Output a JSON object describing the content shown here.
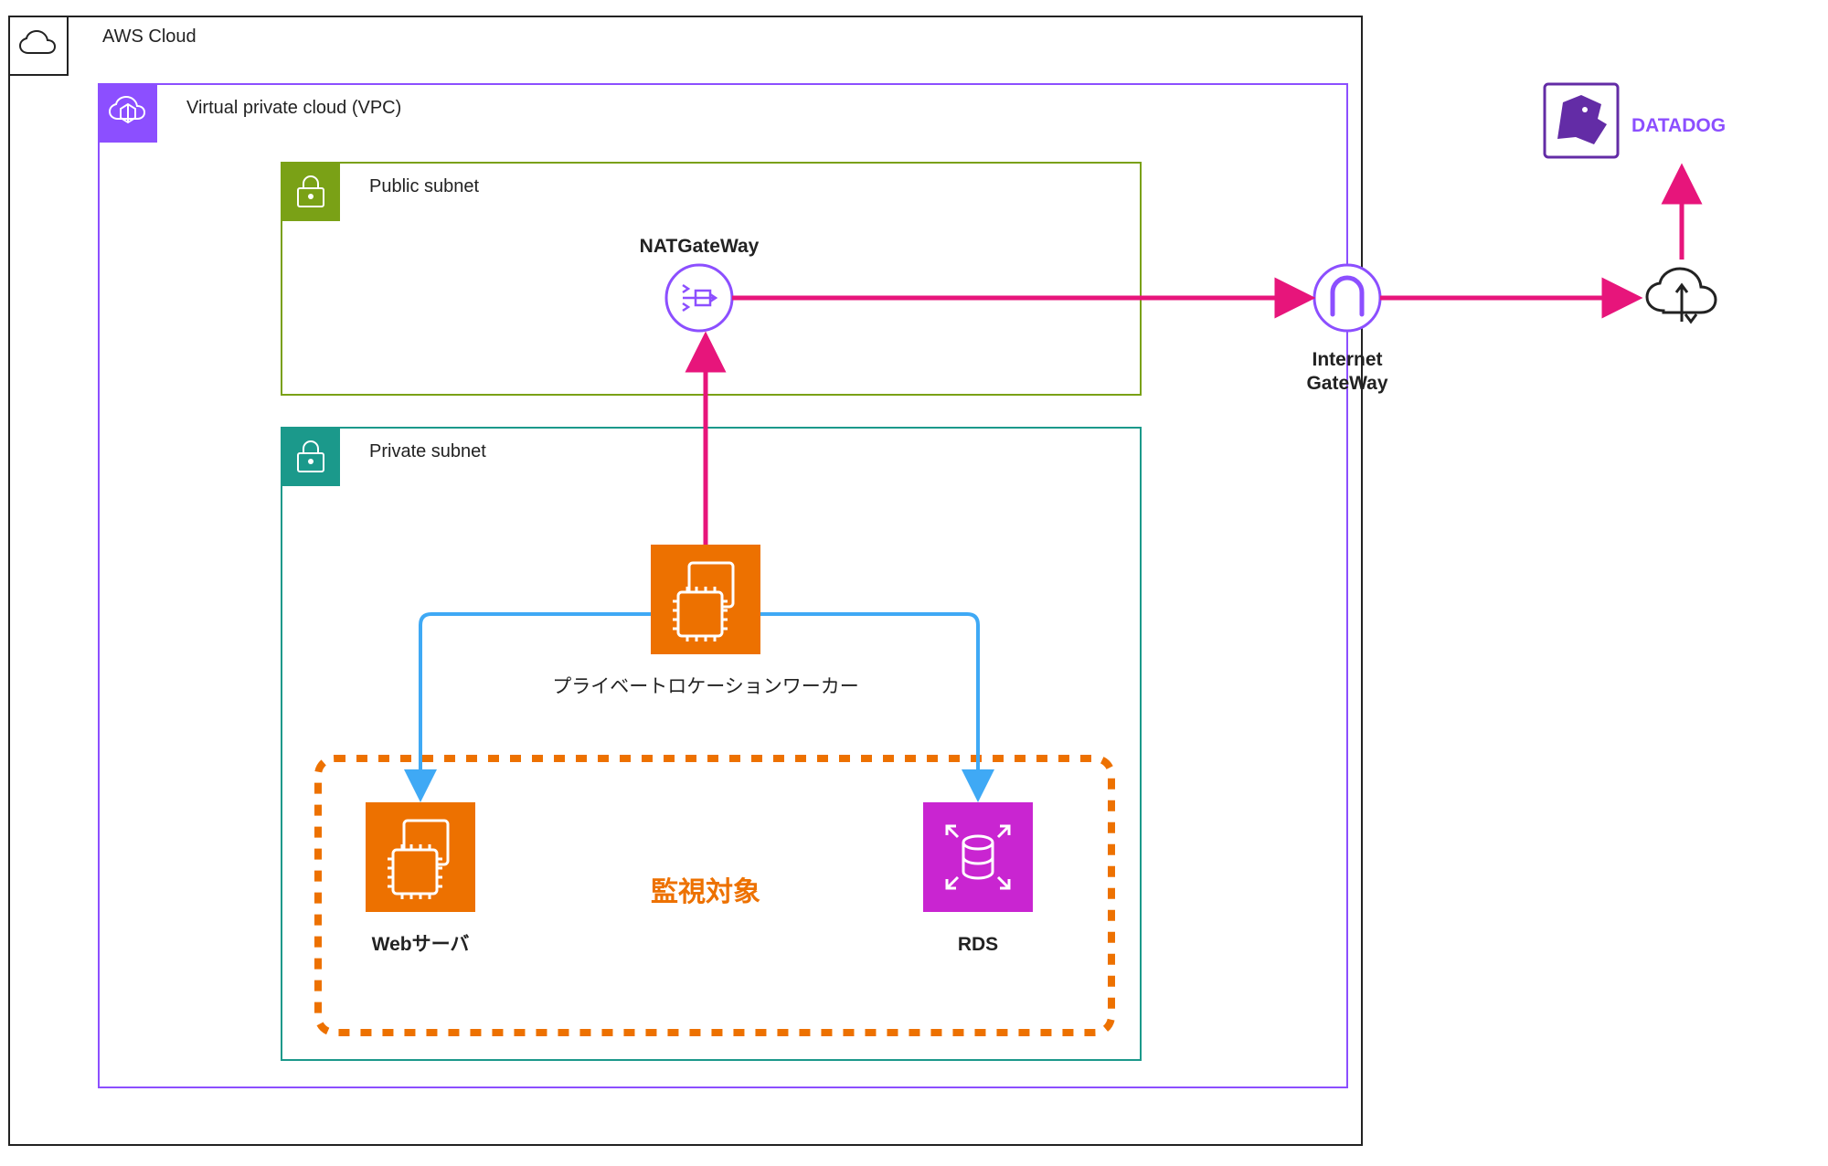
{
  "groups": {
    "aws": {
      "label": "AWS Cloud"
    },
    "vpc": {
      "label": "Virtual private cloud (VPC)"
    },
    "pub": {
      "label": "Public subnet"
    },
    "priv": {
      "label": "Private subnet"
    },
    "watch": {
      "label": "監視対象"
    }
  },
  "nodes": {
    "nat": {
      "label": "NATGateWay"
    },
    "igw": {
      "label": "Internet\nGateWay"
    },
    "worker": {
      "label": "プライベートロケーションワーカー"
    },
    "web": {
      "label": "Webサーバ"
    },
    "rds": {
      "label": "RDS"
    },
    "cloud": {
      "label": ""
    },
    "dd": {
      "label": "DATADOG"
    }
  },
  "chart_data": {
    "type": "diagram",
    "title": "AWS network / Datadog private location architecture",
    "groups": [
      {
        "id": "aws",
        "label": "AWS Cloud",
        "parent": null,
        "badge": "aws-cloud-icon",
        "color": "#222222"
      },
      {
        "id": "vpc",
        "label": "Virtual private cloud (VPC)",
        "parent": "aws",
        "badge": "vpc-icon",
        "color": "#8C4FFF"
      },
      {
        "id": "pub",
        "label": "Public subnet",
        "parent": "vpc",
        "badge": "public-subnet-icon",
        "color": "#7AA116"
      },
      {
        "id": "priv",
        "label": "Private subnet",
        "parent": "vpc",
        "badge": "private-subnet-icon",
        "color": "#1B998B"
      },
      {
        "id": "watch",
        "label": "監視対象",
        "parent": "priv",
        "badge": null,
        "color": "#ED7100",
        "style": "dashed"
      }
    ],
    "nodes": [
      {
        "id": "nat",
        "label": "NATGateWay",
        "group": "pub",
        "icon": "nat-gateway-icon",
        "color": "#8C4FFF"
      },
      {
        "id": "worker",
        "label": "プライベートロケーションワーカー",
        "group": "priv",
        "icon": "ec2-instance-icon",
        "color": "#ED7100"
      },
      {
        "id": "web",
        "label": "Webサーバ",
        "group": "watch",
        "icon": "ec2-instance-icon",
        "color": "#ED7100"
      },
      {
        "id": "rds",
        "label": "RDS",
        "group": "watch",
        "icon": "rds-icon",
        "color": "#C925D1"
      },
      {
        "id": "igw",
        "label": "Internet GateWay",
        "group": "vpc",
        "icon": "internet-gateway-icon",
        "color": "#8C4FFF",
        "on_border": true
      },
      {
        "id": "cloud",
        "label": "",
        "group": null,
        "icon": "internet-cloud-icon",
        "color": "#222222"
      },
      {
        "id": "dd",
        "label": "DATADOG",
        "group": null,
        "icon": "datadog-logo-icon",
        "color": "#632CA6"
      }
    ],
    "edges": [
      {
        "from": "worker",
        "to": "nat",
        "color": "#E7157B",
        "style": "arrow",
        "kind": "outbound"
      },
      {
        "from": "nat",
        "to": "igw",
        "color": "#E7157B",
        "style": "arrow",
        "kind": "outbound"
      },
      {
        "from": "igw",
        "to": "cloud",
        "color": "#E7157B",
        "style": "arrow",
        "kind": "outbound"
      },
      {
        "from": "cloud",
        "to": "dd",
        "color": "#E7157B",
        "style": "arrow",
        "kind": "outbound"
      },
      {
        "from": "worker",
        "to": "web",
        "color": "#3FA9F5",
        "style": "elbow-arrow",
        "kind": "probe"
      },
      {
        "from": "worker",
        "to": "rds",
        "color": "#3FA9F5",
        "style": "elbow-arrow",
        "kind": "probe"
      }
    ]
  }
}
